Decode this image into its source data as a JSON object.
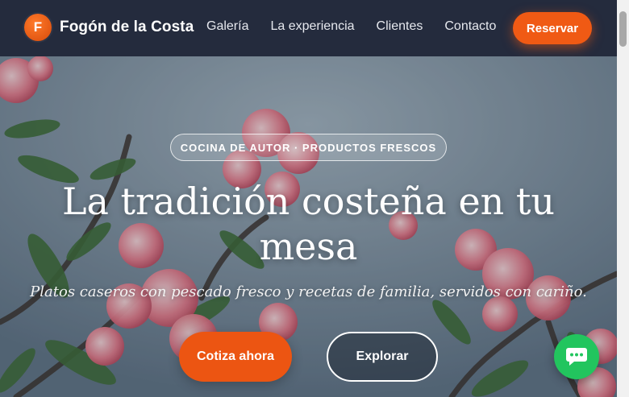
{
  "brand": {
    "initial": "F",
    "name": "Fogón de la Costa"
  },
  "nav": {
    "links": [
      "Galería",
      "La experiencia",
      "Clientes",
      "Contacto"
    ],
    "reserve_label": "Reservar"
  },
  "hero": {
    "badge": "COCINA DE AUTOR · PRODUCTOS FRESCOS",
    "title": "La tradición costeña en tu mesa",
    "subtitle": "Platos caseros con pescado fresco y recetas de familia, servidos con cariño.",
    "cta_primary": "Cotiza ahora",
    "cta_secondary": "Explorar"
  },
  "icons": {
    "logo": "letter-f-logo",
    "chat": "chat-bubble-icon"
  },
  "colors": {
    "accent": "#f05a14",
    "nav_bg": "#242b3d",
    "chat": "#22c55e"
  }
}
